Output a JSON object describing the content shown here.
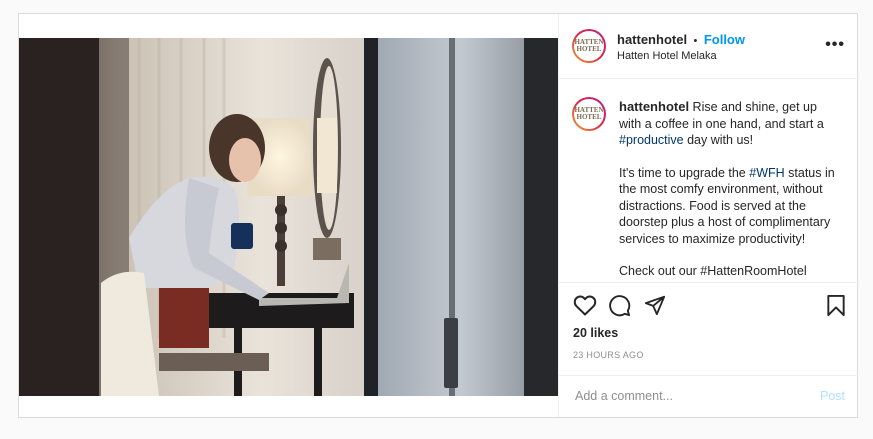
{
  "post": {
    "username": "hattenhotel",
    "separator": "•",
    "follow_label": "Follow",
    "location": "Hatten Hotel Melaka",
    "more_label": "•••",
    "avatar_text": "HATTEN HOTEL",
    "photo_alt": "Woman working at a hotel room desk holding a coffee cup",
    "caption_line1": "Rise and shine, get up with a coffee in one hand, and start a",
    "hashtag1": "#productive",
    "caption_line1_end": "day with us!",
    "caption_p2_start": "It's time to upgrade the",
    "hashtag2": "#WFH",
    "caption_p2_end": "status in the most comfy environment, without distractions. Food is served at the doorstep plus a host of complimentary services to maximize productivity!",
    "caption_p3": "Check out our #HattenRoomHotel",
    "likes": "20 likes",
    "timestamp": "23 HOURS AGO",
    "comment_placeholder": "Add a comment...",
    "post_label": "Post"
  },
  "icons": {
    "like": "heart-icon",
    "comment": "comment-icon",
    "share": "share-icon",
    "save": "bookmark-icon"
  },
  "colors": {
    "link": "#0095f6",
    "hashtag": "#00376b",
    "muted": "#8e8e8e",
    "post_disabled": "#b2dffc"
  }
}
